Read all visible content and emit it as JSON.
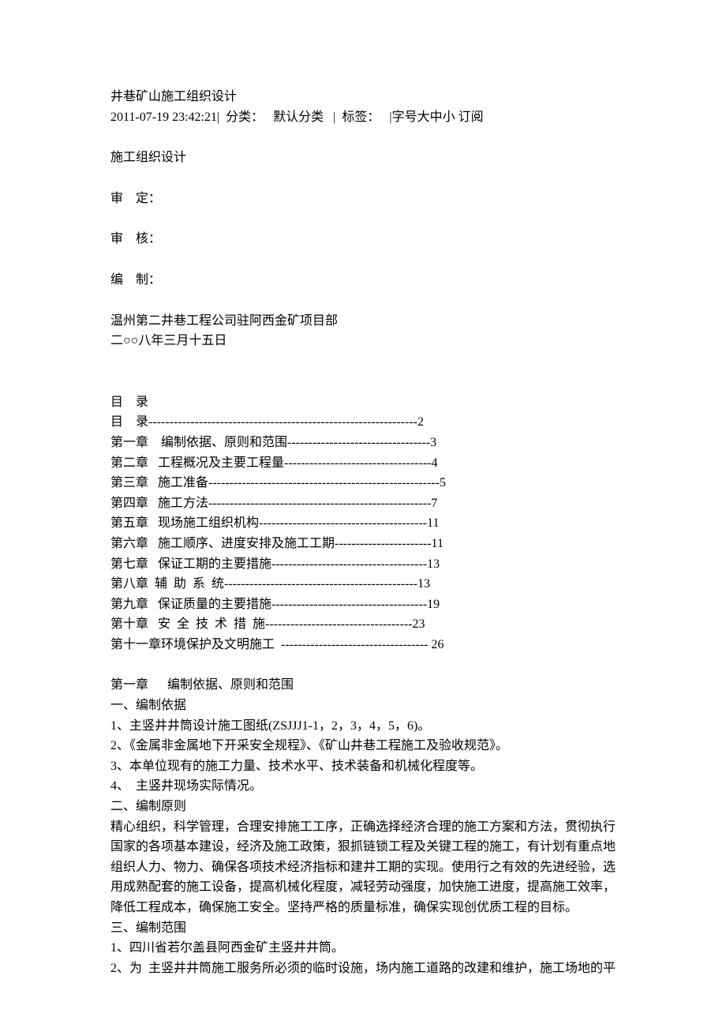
{
  "header": {
    "title": "井巷矿山施工组织设计",
    "meta": "2011-07-19 23:42:21|  分类：   默认分类   |  标签：   |字号大中小 订阅"
  },
  "section1": {
    "l1": "施工组织设计",
    "l2": "审    定：",
    "l3": "审    核：",
    "l4": "编    制：",
    "l5": "温州第二井巷工程公司驻阿西金矿项目部",
    "l6": "二○○八年三月十五日"
  },
  "toc": {
    "title": "目    录",
    "lines": [
      "目    录----------------------------------------------------------------2",
      "第一章    编制依据、原则和范围----------------------------------3",
      "第二章   工程概况及主要工程量-----------------------------------4",
      "第三章   施工准备-------------------------------------------------------5",
      "第四章   施工方法-----------------------------------------------------7",
      "第五章   现场施工组织机构----------------------------------------11",
      "第六章   施工顺序、进度安排及施工工期-----------------------11",
      "第七章   保证工期的主要措施-------------------------------------13",
      "第八章  辅  助  系  统----------------------------------------------13",
      "第九章   保证质量的主要措施-------------------------------------19",
      "第十章   安  全  技  术  措  施-----------------------------------23",
      "第十一章环境保护及文明施工  ----------------------------------- 26"
    ]
  },
  "chapter1": {
    "title": "第一章      编制依据、原则和范围",
    "s1_title": "一、编制依据",
    "s1_lines": [
      "1、主竖井井筒设计施工图纸(ZSJJJ1-1，2，3，4，5，6)。",
      "2、《金属非金属地下开采安全规程》、《矿山井巷工程施工及验收规范》。",
      "3、本单位现有的施工力量、技术水平、技术装备和机械化程度等。",
      "4、  主竖井现场实际情况。"
    ],
    "s2_title": "二、编制原则",
    "s2_para": "精心组织，科学管理，合理安排施工工序，正确选择经济合理的施工方案和方法，贯彻执行国家的各项基本建设，经济及施工政策，狠抓链锁工程及关键工程的施工，有计划有重点地组织人力、物力、确保各项技术经济指标和建井工期的实现。使用行之有效的先进经验，选用成熟配套的施工设备，提高机械化程度，减轻劳动强度，加快施工进度，提高施工效率，降低工程成本，确保施工安全。坚持严格的质量标准，确保实现创优质工程的目标。",
    "s3_title": "三、编制范围",
    "s3_lines": [
      "1、四川省若尔盖县阿西金矿主竖井井筒。",
      "2、为  主竖井井筒施工服务所必须的临时设施，场内施工道路的改建和维护，施工场地的平"
    ]
  }
}
